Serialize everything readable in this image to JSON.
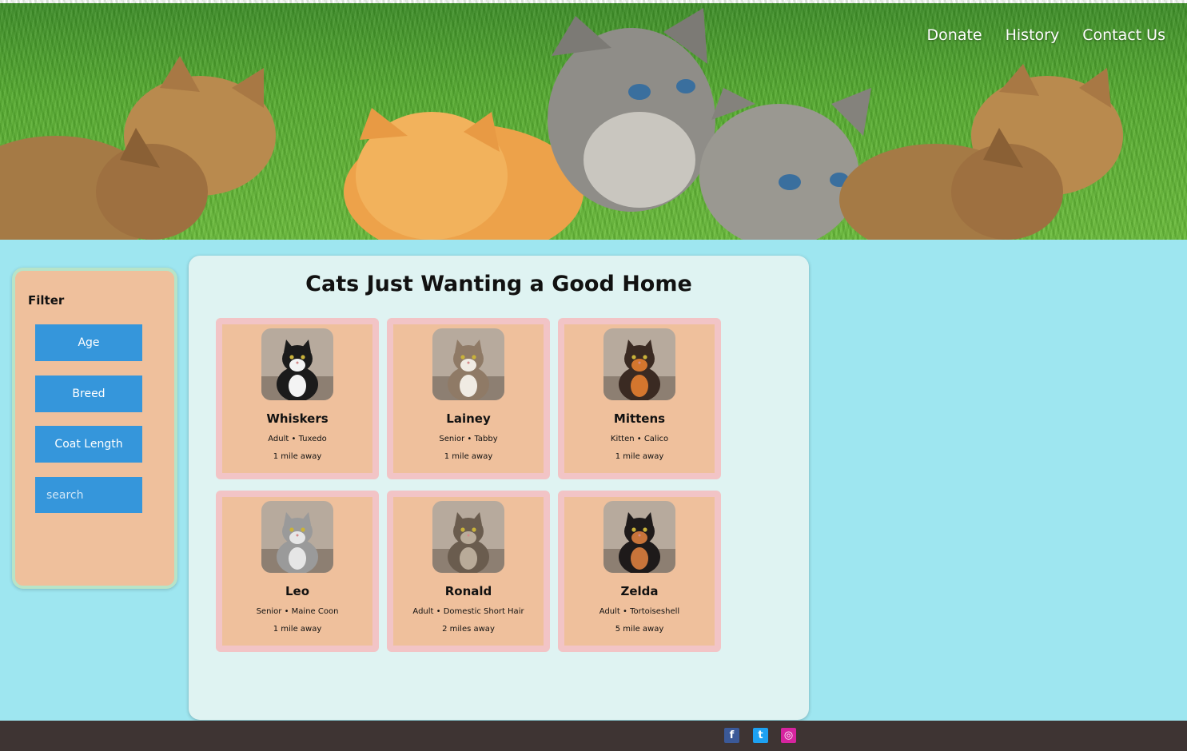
{
  "nav": {
    "items": [
      "Donate",
      "History",
      "Contact Us"
    ]
  },
  "filter": {
    "title": "Filter",
    "buttons": [
      "Age",
      "Breed",
      "Coat Length"
    ],
    "search_placeholder": "search"
  },
  "main": {
    "title": "Cats Just Wanting a Good Home",
    "cats": [
      {
        "name": "Whiskers",
        "desc": "Adult • Tuxedo",
        "distance": "1 mile away",
        "coat": [
          "#1b1b1b",
          "#f3f3f3"
        ]
      },
      {
        "name": "Lainey",
        "desc": "Senior • Tabby",
        "distance": "1 mile away",
        "coat": [
          "#8f7a66",
          "#f0ebe3"
        ]
      },
      {
        "name": "Mittens",
        "desc": "Kitten • Calico",
        "distance": "1 mile away",
        "coat": [
          "#3a2a22",
          "#d4762e"
        ]
      },
      {
        "name": "Leo",
        "desc": "Senior • Maine Coon",
        "distance": "1 mile away",
        "coat": [
          "#9a9a9a",
          "#e6e6e6"
        ]
      },
      {
        "name": "Ronald",
        "desc": "Adult • Domestic Short Hair",
        "distance": "2 miles away",
        "coat": [
          "#6a5c4e",
          "#b9ab99"
        ]
      },
      {
        "name": "Zelda",
        "desc": "Adult • Tortoiseshell",
        "distance": "5 mile away",
        "coat": [
          "#1e1a1a",
          "#c8743a"
        ]
      }
    ]
  },
  "footer": {
    "social": [
      {
        "icon": "facebook-icon",
        "glyph": "f",
        "color": "#3b5998"
      },
      {
        "icon": "twitter-icon",
        "glyph": "t",
        "color": "#1da1f2"
      },
      {
        "icon": "instagram-icon",
        "glyph": "◎",
        "color": "#d6249f"
      }
    ]
  },
  "colors": {
    "page_bg": "#9ee6f0",
    "filter_button": "#3596db",
    "card_bg": "#efc09c",
    "card_border": "#f2c4c6",
    "footer_bg": "#3e3433"
  }
}
